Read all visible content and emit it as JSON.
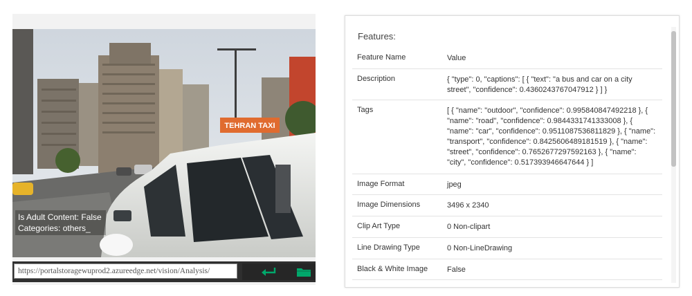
{
  "image_panel": {
    "overlay_adult": "Is Adult Content: False",
    "overlay_categories": "Categories: others_",
    "sign_text": "TEHRAN TAXI",
    "url_value": "https://portalstoragewuprod2.azureedge.net/vision/Analysis/",
    "submit_icon": "enter-arrow-icon",
    "upload_icon": "folder-icon",
    "accent": "#00a86b"
  },
  "features": {
    "title": "Features:",
    "header": {
      "name": "Feature Name",
      "value": "Value"
    },
    "rows": [
      {
        "name": "Description",
        "value": "{ \"type\": 0, \"captions\": [ { \"text\": \"a bus and car on a city street\", \"confidence\": 0.4360243767047912 } ] }"
      },
      {
        "name": "Tags",
        "value": "[ { \"name\": \"outdoor\", \"confidence\": 0.995840847492218 }, { \"name\": \"road\", \"confidence\": 0.9844331741333008 }, { \"name\": \"car\", \"confidence\": 0.9511087536811829 }, { \"name\": \"transport\", \"confidence\": 0.8425606489181519 }, { \"name\": \"street\", \"confidence\": 0.7652677297592163 }, { \"name\": \"city\", \"confidence\": 0.517393946647644 } ]"
      },
      {
        "name": "Image Format",
        "value": "jpeg"
      },
      {
        "name": "Image Dimensions",
        "value": "3496 x 2340"
      },
      {
        "name": "Clip Art Type",
        "value": "0 Non-clipart"
      },
      {
        "name": "Line Drawing Type",
        "value": "0 Non-LineDrawing"
      },
      {
        "name": "Black & White Image",
        "value": "False"
      }
    ]
  }
}
